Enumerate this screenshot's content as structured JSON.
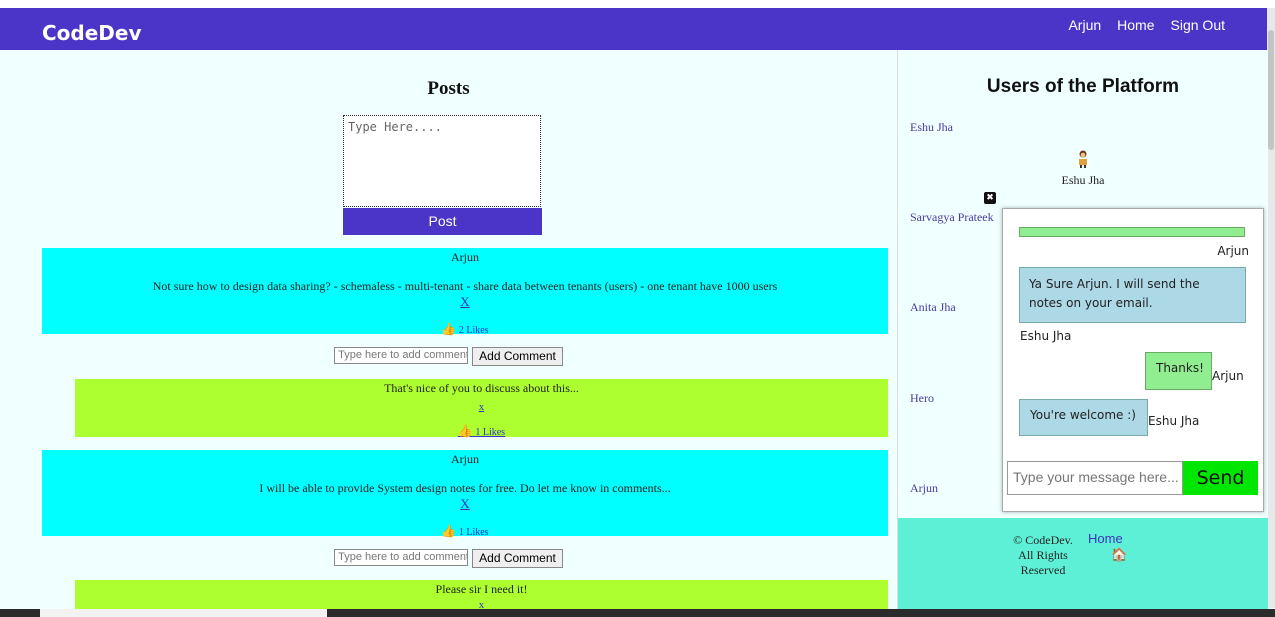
{
  "header": {
    "brand": "CodeDev",
    "links": [
      "Arjun",
      "Home",
      "Sign Out"
    ]
  },
  "posts": {
    "title": "Posts",
    "input_placeholder": "Type Here....",
    "post_button": "Post",
    "comment_placeholder": "Type here to add comment",
    "comment_button": "Add Comment",
    "items": [
      {
        "author": "Arjun",
        "text": "Not sure how to design data sharing? - schemaless - multi-tenant - share data between tenants (users) - one tenant have 1000 users",
        "delete": "X",
        "likes": "2 Likes",
        "comment": {
          "text": "That's nice of you to discuss about this...",
          "delete": "x",
          "likes": "1 Likes"
        }
      },
      {
        "author": "Arjun",
        "text": "I will be able to provide System design notes for free. Do let me know in comments...",
        "delete": "X",
        "likes": "1 Likes",
        "comment": {
          "text": "Please sir I need it!",
          "delete": "x"
        }
      }
    ]
  },
  "sidebar": {
    "title": "Users of the Platform",
    "users": [
      "Eshu Jha",
      "Sarvagya Prateek",
      "Anita Jha",
      "Hero",
      "Arjun"
    ],
    "avatar_name": "Eshu Jha",
    "close": "✖"
  },
  "chat": {
    "top_label": "Arjun",
    "messages": [
      {
        "text": "Ya Sure Arjun. I will send the notes on your email.",
        "sender": "Eshu Jha"
      },
      {
        "text": "Thanks!",
        "sender": "Arjun"
      },
      {
        "text": "You're welcome :)",
        "sender": "Eshu Jha"
      }
    ],
    "input_placeholder": "Type your message here...",
    "send": "Send"
  },
  "footer": {
    "copyright": "© CodeDev. All Rights Reserved",
    "home": "Home"
  },
  "colors": {
    "nav": "#4b35c9",
    "post_bg": "#00ffff",
    "comment_bg": "#adff2f",
    "footer_bg": "#5ef0d6",
    "send_bg": "#00e600"
  }
}
